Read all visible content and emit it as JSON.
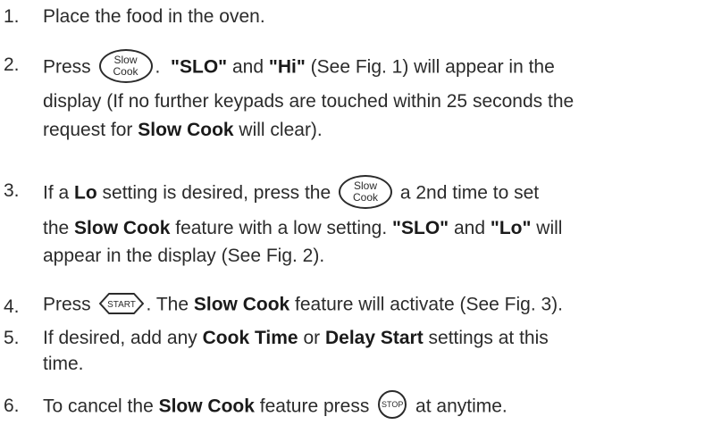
{
  "steps": [
    {
      "num": "1.",
      "text": "Place the food in the oven."
    },
    {
      "num": "2.",
      "pre": "Press",
      "key_top": "Slow",
      "key_bottom": "Cook",
      "mid": ".",
      "b1": "\"SLO\"",
      "t1": "and",
      "b2": "\"Hi\"",
      "t2": "(See Fig. 1) will appear in the",
      "line2": "display (If no further keypads are touched within 25 seconds the",
      "line3_pre": "request for",
      "line3_b": "Slow Cook",
      "line3_post": "will clear)."
    },
    {
      "num": "3.",
      "pre": "If a",
      "b_lo": "Lo",
      "t1": "setting is desired, press the",
      "key_top": "Slow",
      "key_bottom": "Cook",
      "t2": "a 2nd time to set",
      "line2_pre": "the",
      "line2_b1": "Slow Cook",
      "line2_mid": "feature with a low setting.",
      "line2_b2": "\"SLO\"",
      "line2_and": "and",
      "line2_b3": "\"Lo\"",
      "line2_post": "will",
      "line3": "appear in the display (See Fig. 2)."
    },
    {
      "num": "4.",
      "pre": "Press",
      "key": "START",
      "t1": ". The",
      "b1": "Slow Cook",
      "t2": "feature will activate (See Fig. 3)."
    },
    {
      "num": "5.",
      "pre": "If desired, add any",
      "b1": "Cook Time",
      "t1": "or",
      "b2": "Delay Start",
      "t2": "settings at this",
      "line2": "time."
    },
    {
      "num": "6.",
      "pre": "To cancel the",
      "b1": "Slow Cook",
      "t1": "feature press",
      "key": "STOP",
      "t2": "at anytime."
    }
  ]
}
